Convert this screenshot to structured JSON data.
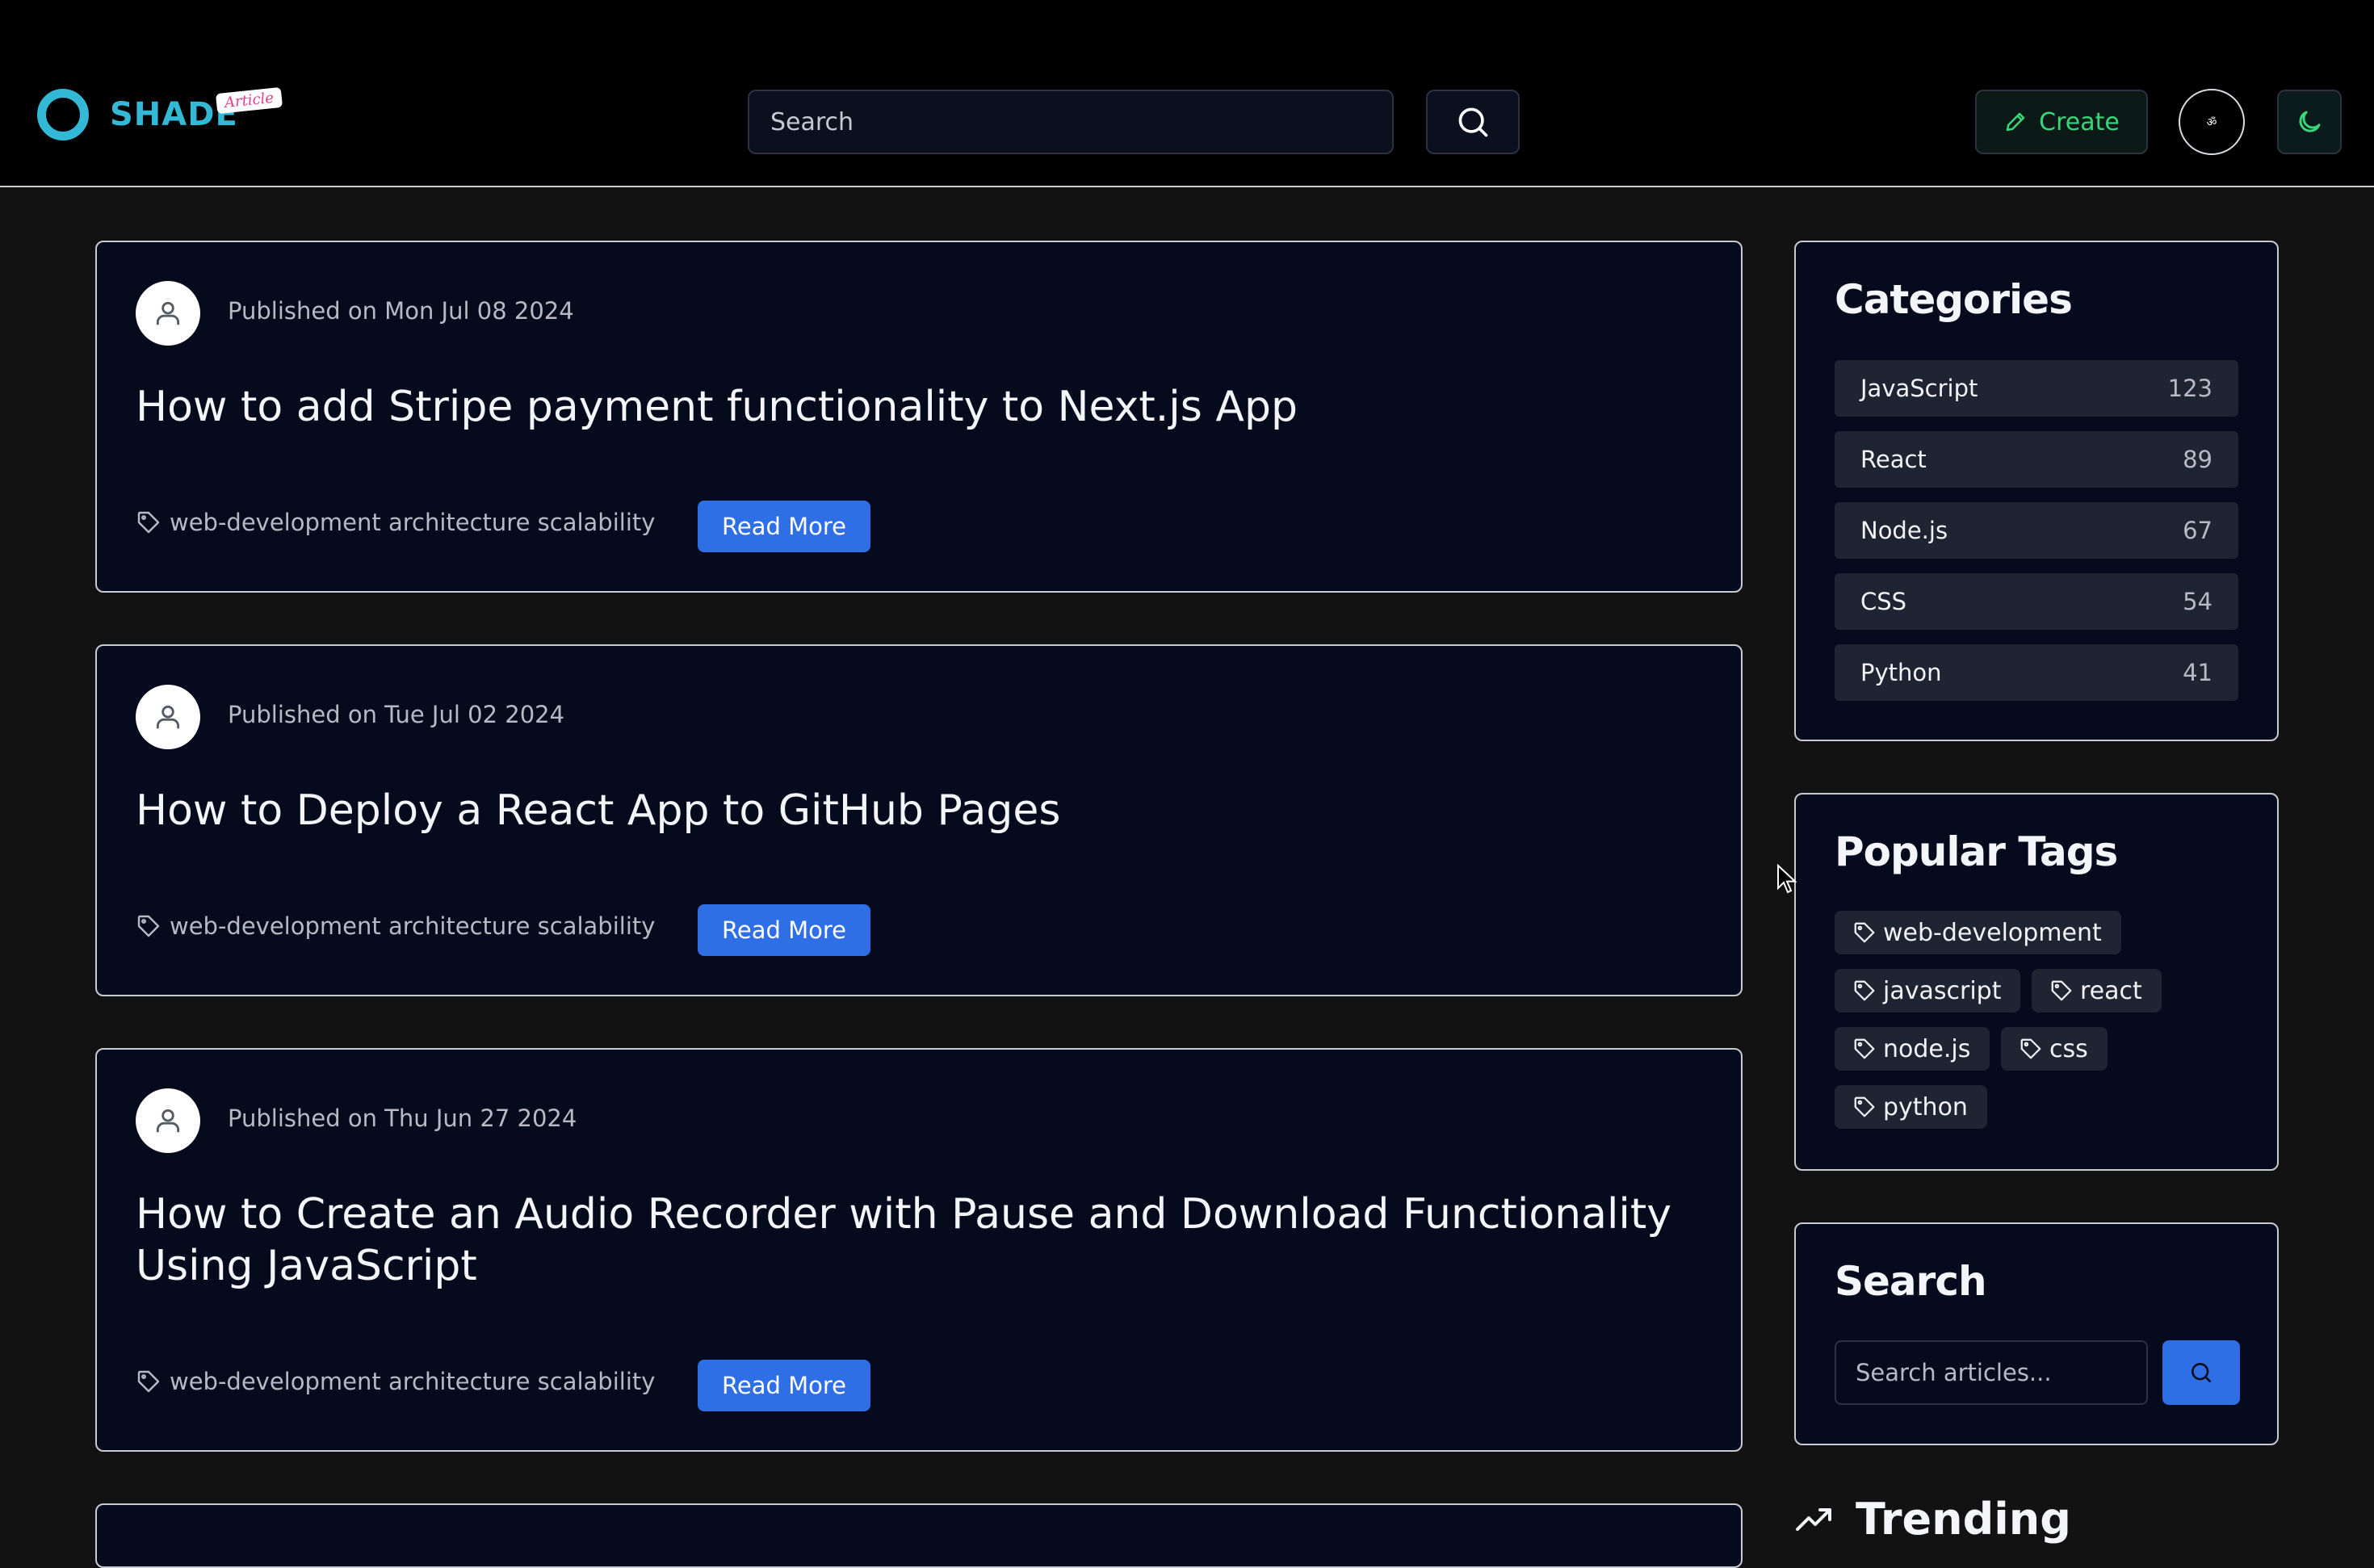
{
  "header": {
    "logo_text": "SHADE",
    "logo_badge": "Article",
    "search_placeholder": "Search",
    "create_label": "Create",
    "avatar_text": "ॐ"
  },
  "articles": [
    {
      "date": "Published on Mon Jul 08 2024",
      "title": "How to add Stripe payment functionality to Next.js App",
      "tags": "web-development architecture scalability",
      "read_more": "Read More"
    },
    {
      "date": "Published on Tue Jul 02 2024",
      "title": "How to Deploy a React App to GitHub Pages",
      "tags": "web-development architecture scalability",
      "read_more": "Read More"
    },
    {
      "date": "Published on Thu Jun 27 2024",
      "title": "How to Create an Audio Recorder with Pause and Download Functionality Using JavaScript",
      "tags": "web-development architecture scalability",
      "read_more": "Read More"
    }
  ],
  "sidebar": {
    "categories": {
      "title": "Categories",
      "items": [
        {
          "name": "JavaScript",
          "count": "123"
        },
        {
          "name": "React",
          "count": "89"
        },
        {
          "name": "Node.js",
          "count": "67"
        },
        {
          "name": "CSS",
          "count": "54"
        },
        {
          "name": "Python",
          "count": "41"
        }
      ]
    },
    "popular_tags": {
      "title": "Popular Tags",
      "tags": [
        "web-development",
        "javascript",
        "react",
        "node.js",
        "css",
        "python"
      ]
    },
    "search": {
      "title": "Search",
      "placeholder": "Search articles..."
    },
    "trending": {
      "title": "Trending"
    }
  },
  "colors": {
    "accent": "#2f6fe6",
    "logo": "#33b8d6",
    "create": "#37d67a"
  }
}
